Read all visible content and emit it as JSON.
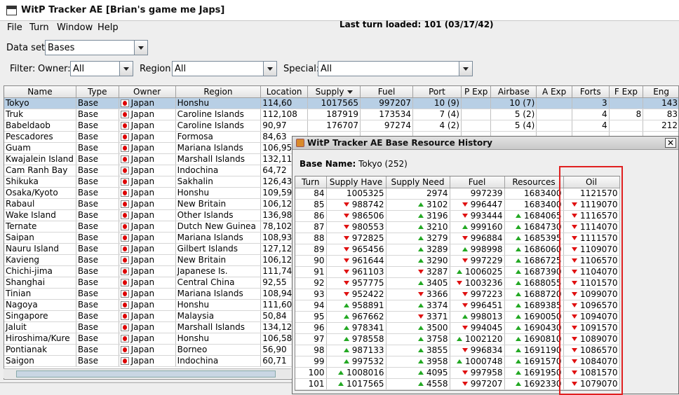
{
  "window": {
    "title": "WitP Tracker AE [Brian's game me Japs]"
  },
  "menu": [
    "File",
    "Turn",
    "Window",
    "Help"
  ],
  "last_turn": "Last turn loaded: 101 (03/17/42)",
  "dataset": {
    "label": "Data set:",
    "value": "Bases"
  },
  "filter": {
    "label": "Filter:",
    "owner_label": "Owner:",
    "owner_value": "All",
    "region_label": "Region:",
    "region_value": "All",
    "special_label": "Special:",
    "special_value": "All"
  },
  "main_columns": [
    "Name",
    "Type",
    "Owner",
    "Region",
    "Location",
    "Supply",
    "Fuel",
    "Port",
    "P Exp",
    "Airbase",
    "A Exp",
    "Forts",
    "F Exp",
    "Eng"
  ],
  "main_rows": [
    [
      "Tokyo",
      "Base",
      "Japan",
      "Honshu",
      "114,60",
      "1017565",
      "997207",
      "10 (9)",
      "",
      "10 (7)",
      "",
      "3",
      "",
      "143"
    ],
    [
      "Truk",
      "Base",
      "Japan",
      "Caroline Islands",
      "112,108",
      "187919",
      "173534",
      "7 (4)",
      "",
      "5 (2)",
      "",
      "4",
      "8",
      "83"
    ],
    [
      "Babeldaob",
      "Base",
      "Japan",
      "Caroline Islands",
      "90,97",
      "176707",
      "97274",
      "4 (2)",
      "",
      "5 (4)",
      "",
      "4",
      "",
      "212"
    ],
    [
      "Pescadores",
      "Base",
      "Japan",
      "Formosa",
      "84,63",
      "",
      "",
      "",
      "",
      "",
      "",
      "",
      "",
      ""
    ],
    [
      "Guam",
      "Base",
      "Japan",
      "Mariana Islands",
      "106,95",
      "",
      "",
      "",
      "",
      "",
      "",
      "",
      "",
      ""
    ],
    [
      "Kwajalein Island",
      "Base",
      "Japan",
      "Marshall Islands",
      "132,115",
      "",
      "",
      "",
      "",
      "",
      "",
      "",
      "",
      ""
    ],
    [
      "Cam Ranh Bay",
      "Base",
      "Japan",
      "Indochina",
      "64,72",
      "",
      "",
      "",
      "",
      "",
      "",
      "",
      "",
      ""
    ],
    [
      "Shikuka",
      "Base",
      "Japan",
      "Sakhalin",
      "126,43",
      "",
      "",
      "",
      "",
      "",
      "",
      "",
      "",
      ""
    ],
    [
      "Osaka/Kyoto",
      "Base",
      "Japan",
      "Honshu",
      "109,59",
      "",
      "",
      "",
      "",
      "",
      "",
      "",
      "",
      ""
    ],
    [
      "Rabaul",
      "Base",
      "Japan",
      "New Britain",
      "106,125",
      "",
      "",
      "",
      "",
      "",
      "",
      "",
      "",
      ""
    ],
    [
      "Wake Island",
      "Base",
      "Japan",
      "Other Islands",
      "136,98",
      "",
      "",
      "",
      "",
      "",
      "",
      "",
      "",
      ""
    ],
    [
      "Ternate",
      "Base",
      "Japan",
      "Dutch New Guinea",
      "78,102",
      "",
      "",
      "",
      "",
      "",
      "",
      "",
      "",
      ""
    ],
    [
      "Saipan",
      "Base",
      "Japan",
      "Mariana Islands",
      "108,93",
      "",
      "",
      "",
      "",
      "",
      "",
      "",
      "",
      ""
    ],
    [
      "Nauru Island",
      "Base",
      "Japan",
      "Gilbert Islands",
      "127,128",
      "",
      "",
      "",
      "",
      "",
      "",
      "",
      "",
      ""
    ],
    [
      "Kavieng",
      "Base",
      "Japan",
      "New Britain",
      "106,122",
      "",
      "",
      "",
      "",
      "",
      "",
      "",
      "",
      ""
    ],
    [
      "Chichi-jima",
      "Base",
      "Japan",
      "Japanese Is.",
      "111,74",
      "",
      "",
      "",
      "",
      "",
      "",
      "",
      "",
      ""
    ],
    [
      "Shanghai",
      "Base",
      "Japan",
      "Central China",
      "92,55",
      "",
      "",
      "",
      "",
      "",
      "",
      "",
      "",
      ""
    ],
    [
      "Tinian",
      "Base",
      "Japan",
      "Mariana Islands",
      "108,94",
      "",
      "",
      "",
      "",
      "",
      "",
      "",
      "",
      ""
    ],
    [
      "Nagoya",
      "Base",
      "Japan",
      "Honshu",
      "111,60",
      "",
      "",
      "",
      "",
      "",
      "",
      "",
      "",
      ""
    ],
    [
      "Singapore",
      "Base",
      "Japan",
      "Malaysia",
      "50,84",
      "",
      "",
      "",
      "",
      "",
      "",
      "",
      "",
      ""
    ],
    [
      "Jaluit",
      "Base",
      "Japan",
      "Marshall Islands",
      "134,120",
      "",
      "",
      "",
      "",
      "",
      "",
      "",
      "",
      ""
    ],
    [
      "Hiroshima/Kure",
      "Base",
      "Japan",
      "Honshu",
      "106,58",
      "",
      "",
      "",
      "",
      "",
      "",
      "",
      "",
      ""
    ],
    [
      "Pontianak",
      "Base",
      "Japan",
      "Borneo",
      "56,90",
      "",
      "",
      "",
      "",
      "",
      "",
      "",
      "",
      ""
    ],
    [
      "Saigon",
      "Base",
      "Japan",
      "Indochina",
      "60,71",
      "",
      "",
      "",
      "",
      "",
      "",
      "",
      "",
      ""
    ]
  ],
  "dialog": {
    "title": "WitP Tracker AE Base Resource History",
    "base_label": "Base Name:",
    "base_value": "Tokyo (252)",
    "columns": [
      "Turn",
      "Supply Have",
      "Supply Need",
      "Fuel",
      "Resources",
      "Oil"
    ],
    "rows": [
      {
        "turn": "84",
        "supply_have": "1005325",
        "sh": "",
        "supply_need": "2974",
        "sn": "",
        "fuel": "997239",
        "fu": "",
        "resources": "1683400",
        "re": "",
        "oil": "1121570",
        "oi": ""
      },
      {
        "turn": "85",
        "supply_have": "988742",
        "sh": "down",
        "supply_need": "3102",
        "sn": "up",
        "fuel": "996447",
        "fu": "down",
        "resources": "1683400",
        "re": "",
        "oil": "1119070",
        "oi": "down"
      },
      {
        "turn": "86",
        "supply_have": "986506",
        "sh": "down",
        "supply_need": "3196",
        "sn": "up",
        "fuel": "993444",
        "fu": "down",
        "resources": "1684065",
        "re": "up",
        "oil": "1116570",
        "oi": "down"
      },
      {
        "turn": "87",
        "supply_have": "980553",
        "sh": "down",
        "supply_need": "3210",
        "sn": "up",
        "fuel": "999160",
        "fu": "up",
        "resources": "1684730",
        "re": "up",
        "oil": "1114070",
        "oi": "down"
      },
      {
        "turn": "88",
        "supply_have": "972825",
        "sh": "down",
        "supply_need": "3279",
        "sn": "up",
        "fuel": "996884",
        "fu": "down",
        "resources": "1685395",
        "re": "up",
        "oil": "1111570",
        "oi": "down"
      },
      {
        "turn": "89",
        "supply_have": "965456",
        "sh": "down",
        "supply_need": "3289",
        "sn": "up",
        "fuel": "998998",
        "fu": "up",
        "resources": "1686060",
        "re": "up",
        "oil": "1109070",
        "oi": "down"
      },
      {
        "turn": "90",
        "supply_have": "961644",
        "sh": "down",
        "supply_need": "3290",
        "sn": "up",
        "fuel": "997229",
        "fu": "down",
        "resources": "1686725",
        "re": "up",
        "oil": "1106570",
        "oi": "down"
      },
      {
        "turn": "91",
        "supply_have": "961103",
        "sh": "down",
        "supply_need": "3287",
        "sn": "down",
        "fuel": "1006025",
        "fu": "up",
        "resources": "1687390",
        "re": "up",
        "oil": "1104070",
        "oi": "down"
      },
      {
        "turn": "92",
        "supply_have": "957775",
        "sh": "down",
        "supply_need": "3405",
        "sn": "up",
        "fuel": "1003236",
        "fu": "down",
        "resources": "1688055",
        "re": "up",
        "oil": "1101570",
        "oi": "down"
      },
      {
        "turn": "93",
        "supply_have": "952422",
        "sh": "down",
        "supply_need": "3366",
        "sn": "down",
        "fuel": "997223",
        "fu": "down",
        "resources": "1688720",
        "re": "up",
        "oil": "1099070",
        "oi": "down"
      },
      {
        "turn": "94",
        "supply_have": "958891",
        "sh": "up",
        "supply_need": "3374",
        "sn": "up",
        "fuel": "996451",
        "fu": "down",
        "resources": "1689385",
        "re": "up",
        "oil": "1096570",
        "oi": "down"
      },
      {
        "turn": "95",
        "supply_have": "967662",
        "sh": "up",
        "supply_need": "3371",
        "sn": "down",
        "fuel": "998013",
        "fu": "up",
        "resources": "1690050",
        "re": "up",
        "oil": "1094070",
        "oi": "down"
      },
      {
        "turn": "96",
        "supply_have": "978341",
        "sh": "up",
        "supply_need": "3500",
        "sn": "up",
        "fuel": "994045",
        "fu": "down",
        "resources": "1690430",
        "re": "up",
        "oil": "1091570",
        "oi": "down"
      },
      {
        "turn": "97",
        "supply_have": "978558",
        "sh": "up",
        "supply_need": "3758",
        "sn": "up",
        "fuel": "1002120",
        "fu": "up",
        "resources": "1690810",
        "re": "up",
        "oil": "1089070",
        "oi": "down"
      },
      {
        "turn": "98",
        "supply_have": "987133",
        "sh": "up",
        "supply_need": "3855",
        "sn": "up",
        "fuel": "996834",
        "fu": "down",
        "resources": "1691190",
        "re": "up",
        "oil": "1086570",
        "oi": "down"
      },
      {
        "turn": "99",
        "supply_have": "997532",
        "sh": "up",
        "supply_need": "3958",
        "sn": "up",
        "fuel": "1000748",
        "fu": "up",
        "resources": "1691570",
        "re": "up",
        "oil": "1084070",
        "oi": "down"
      },
      {
        "turn": "100",
        "supply_have": "1008016",
        "sh": "up",
        "supply_need": "4095",
        "sn": "up",
        "fuel": "997958",
        "fu": "down",
        "resources": "1691950",
        "re": "up",
        "oil": "1081570",
        "oi": "down"
      },
      {
        "turn": "101",
        "supply_have": "1017565",
        "sh": "up",
        "supply_need": "4558",
        "sn": "up",
        "fuel": "997207",
        "fu": "down",
        "resources": "1692330",
        "re": "up",
        "oil": "1079070",
        "oi": "down"
      }
    ]
  },
  "colors": {
    "selection": "#b8cfe5",
    "up_arrow": "#22a822",
    "down_arrow": "#e01010",
    "highlight_box": "#e02020"
  }
}
